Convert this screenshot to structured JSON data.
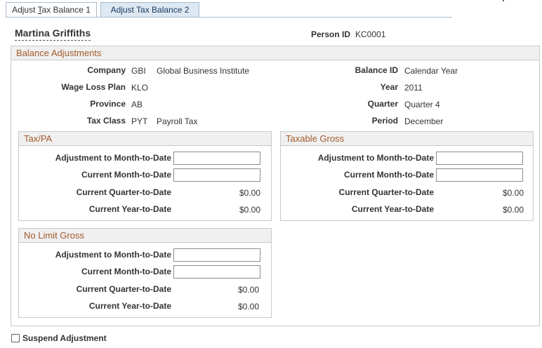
{
  "tabs": {
    "tab1_pre": "Adjust ",
    "tab1_underlined": "T",
    "tab1_post": "ax Balance 1",
    "tab2": "Adjust Tax Balance 2"
  },
  "header": {
    "employee_name": "Martina Griffiths",
    "person_id_label": "Person ID",
    "person_id": "KC0001"
  },
  "balance": {
    "title": "Balance Adjustments",
    "company_label": "Company",
    "company_code": "GBI",
    "company_name": "Global Business Institute",
    "wage_loss_label": "Wage Loss Plan",
    "wage_loss_code": "KLO",
    "province_label": "Province",
    "province_code": "AB",
    "tax_class_label": "Tax Class",
    "tax_class_code": "PYT",
    "tax_class_name": "Payroll Tax",
    "balance_id_label": "Balance ID",
    "balance_id": "Calendar Year",
    "year_label": "Year",
    "year": "2011",
    "quarter_label": "Quarter",
    "quarter": "Quarter 4",
    "period_label": "Period",
    "period": "December"
  },
  "groups": {
    "taxpa": {
      "title": "Tax/PA",
      "adj_mtd_label": "Adjustment to Month-to-Date",
      "adj_mtd_value": "",
      "cur_mtd_label": "Current Month-to-Date",
      "cur_mtd_value": "",
      "cur_qtd_label": "Current Quarter-to-Date",
      "cur_qtd_value": "$0.00",
      "cur_ytd_label": "Current Year-to-Date",
      "cur_ytd_value": "$0.00"
    },
    "taxable": {
      "title": "Taxable Gross",
      "adj_mtd_label": "Adjustment to Month-to-Date",
      "adj_mtd_value": "",
      "cur_mtd_label": "Current Month-to-Date",
      "cur_mtd_value": "",
      "cur_qtd_label": "Current Quarter-to-Date",
      "cur_qtd_value": "$0.00",
      "cur_ytd_label": "Current Year-to-Date",
      "cur_ytd_value": "$0.00"
    },
    "nolimit": {
      "title": "No Limit Gross",
      "adj_mtd_label": "Adjustment to Month-to-Date",
      "adj_mtd_value": "",
      "cur_mtd_label": "Current Month-to-Date",
      "cur_mtd_value": "",
      "cur_qtd_label": "Current Quarter-to-Date",
      "cur_qtd_value": "$0.00",
      "cur_ytd_label": "Current Year-to-Date",
      "cur_ytd_value": "$0.00"
    }
  },
  "footer": {
    "suspend_label": "Suspend Adjustment"
  }
}
